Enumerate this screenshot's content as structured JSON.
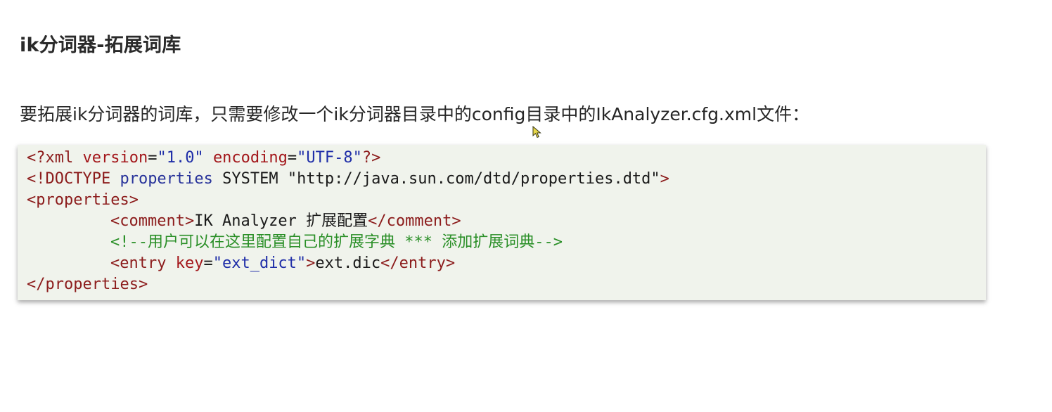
{
  "heading": "ik分词器-拓展词库",
  "intro": "要拓展ik分词器的词库，只需要修改一个ik分词器目录中的config目录中的IkAnalyzer.cfg.xml文件：",
  "code": {
    "line1": {
      "open": "<?xml ",
      "attr1": "version",
      "eq1": "=",
      "val1": "\"1.0\"",
      "space": " ",
      "attr2": "encoding",
      "eq2": "=",
      "val2": "\"UTF-8\"",
      "close": "?>"
    },
    "line2": {
      "open": "<!DOCTYPE ",
      "kw": "properties",
      "plain": " SYSTEM \"http://java.sun.com/dtd/properties.dtd\"",
      "close": ">"
    },
    "line3": {
      "tag": "<properties>"
    },
    "line4": {
      "open": "<comment>",
      "text": "IK Analyzer 扩展配置",
      "close": "</comment>"
    },
    "line5": {
      "comment": "<!--用户可以在这里配置自己的扩展字典 *** 添加扩展词典-->"
    },
    "line6": {
      "open": "<entry ",
      "attr": "key",
      "eq": "=",
      "val": "\"ext_dict\"",
      "gt": ">",
      "text": "ext.dic",
      "close": "</entry>"
    },
    "line7": {
      "tag": "</properties>"
    }
  },
  "colors": {
    "code_background": "#f0f3ec",
    "tag": "#8c1c1c",
    "attribute": "#a3161a",
    "string": "#1f2ea8",
    "comment": "#2a8f27",
    "cursor": "#e8d84a"
  },
  "icons": {
    "cursor": "mouse-pointer-icon"
  }
}
